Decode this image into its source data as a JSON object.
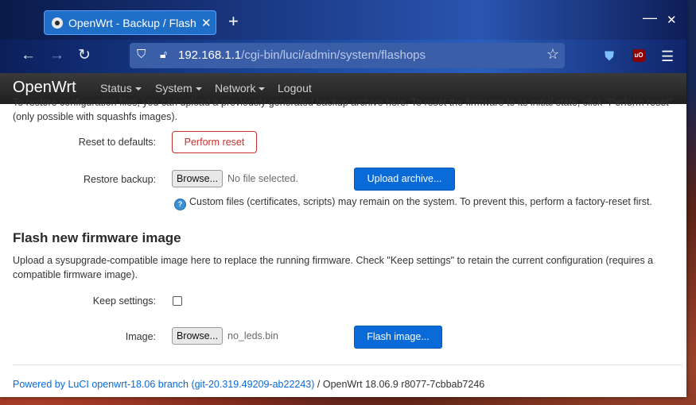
{
  "browser": {
    "tab_title": "OpenWrt - Backup / Flash Firmware",
    "tab_close": "✕",
    "new_tab": "+",
    "url_host": "192.168.1.1",
    "url_path": "/cgi-bin/luci/admin/system/flashops",
    "window_minimize": "—",
    "window_close": "✕"
  },
  "header": {
    "brand": "OpenWrt",
    "menu": [
      {
        "label": "Status"
      },
      {
        "label": "System"
      },
      {
        "label": "Network"
      },
      {
        "label": "Logout"
      }
    ]
  },
  "restore": {
    "cut_text": "To restore configuration files, you can upload a previously generated backup archive here. To reset the firmware to its initial state, click \"Perform reset\" (only possible with squashfs images).",
    "reset_label": "Reset to defaults:",
    "reset_button": "Perform reset",
    "restore_label": "Restore backup:",
    "browse_button": "Browse...",
    "restore_file": "No file selected.",
    "upload_button": "Upload archive...",
    "help_text": "Custom files (certificates, scripts) may remain on the system. To prevent this, perform a factory-reset first."
  },
  "flash": {
    "title": "Flash new firmware image",
    "description": "Upload a sysupgrade-compatible image here to replace the running firmware. Check \"Keep settings\" to retain the current configuration (requires a compatible firmware image).",
    "keep_label": "Keep settings:",
    "keep_checked": false,
    "image_label": "Image:",
    "browse_button": "Browse...",
    "image_file": "no_leds.bin",
    "flash_button": "Flash image..."
  },
  "footer": {
    "link": "Powered by LuCI openwrt-18.06 branch (git-20.319.49209-ab22243)",
    "separator": " / ",
    "version": "OpenWrt 18.06.9 r8077-7cbbab7246"
  },
  "colors": {
    "primary": "#0a6ad8",
    "danger": "#c53030",
    "header_bg": "#2a2a2a"
  }
}
